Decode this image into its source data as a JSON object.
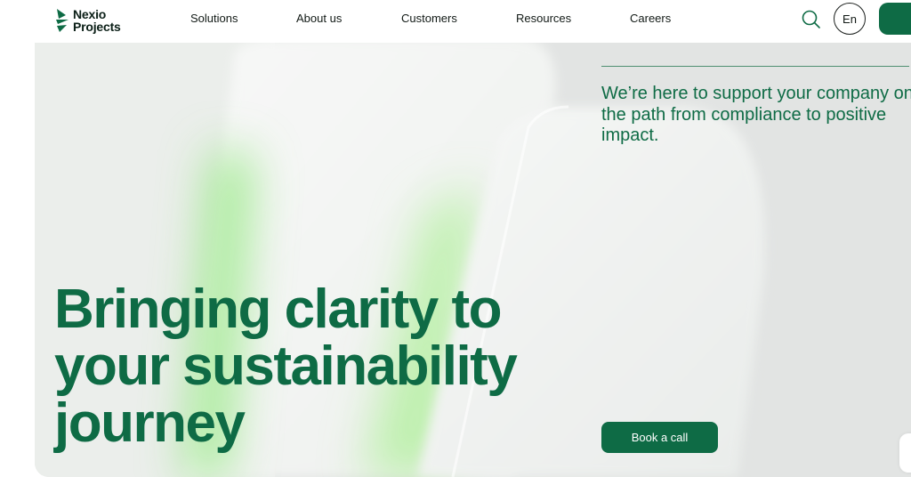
{
  "brand": {
    "name_line1": "Nexio",
    "name_line2": "Projects",
    "logo_icon": "nexio-leaf-mark",
    "primary_color": "#0e6b45"
  },
  "nav": {
    "items": [
      {
        "label": "Solutions"
      },
      {
        "label": "About us"
      },
      {
        "label": "Customers"
      },
      {
        "label": "Resources"
      },
      {
        "label": "Careers"
      }
    ],
    "search_icon": "search-icon",
    "language": "En"
  },
  "hero": {
    "subtitle": "We’re here to support your company on the path from compliance to positive impact.",
    "title_line1": "Bringing clarity to",
    "title_line2": "your sustainability",
    "title_line3": "journey",
    "cta_label": "Book a call",
    "background_color": "#e2e4e3",
    "accent_glow_color": "#8de87a"
  }
}
